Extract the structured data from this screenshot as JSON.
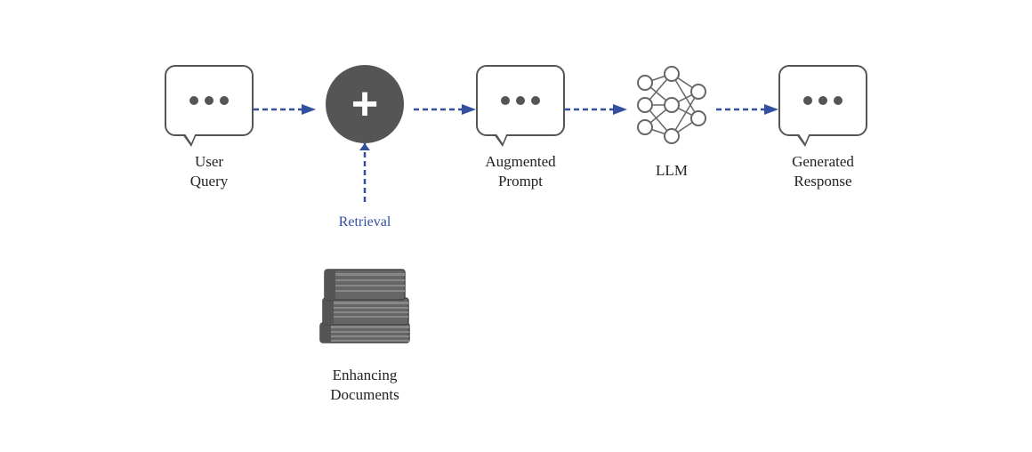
{
  "nodes": {
    "user_query": {
      "label_line1": "User",
      "label_line2": "Query"
    },
    "augmented_prompt": {
      "label_line1": "Augmented",
      "label_line2": "Prompt"
    },
    "llm": {
      "label_line1": "LLM",
      "label_line2": ""
    },
    "generated_response": {
      "label_line1": "Generated",
      "label_line2": "Response"
    },
    "enhancing_docs": {
      "label_line1": "Enhancing",
      "label_line2": "Documents"
    },
    "retrieval": {
      "label": "Retrieval"
    }
  },
  "colors": {
    "arrow": "#334fa0",
    "icon_fill": "#555555",
    "text": "#222222"
  }
}
